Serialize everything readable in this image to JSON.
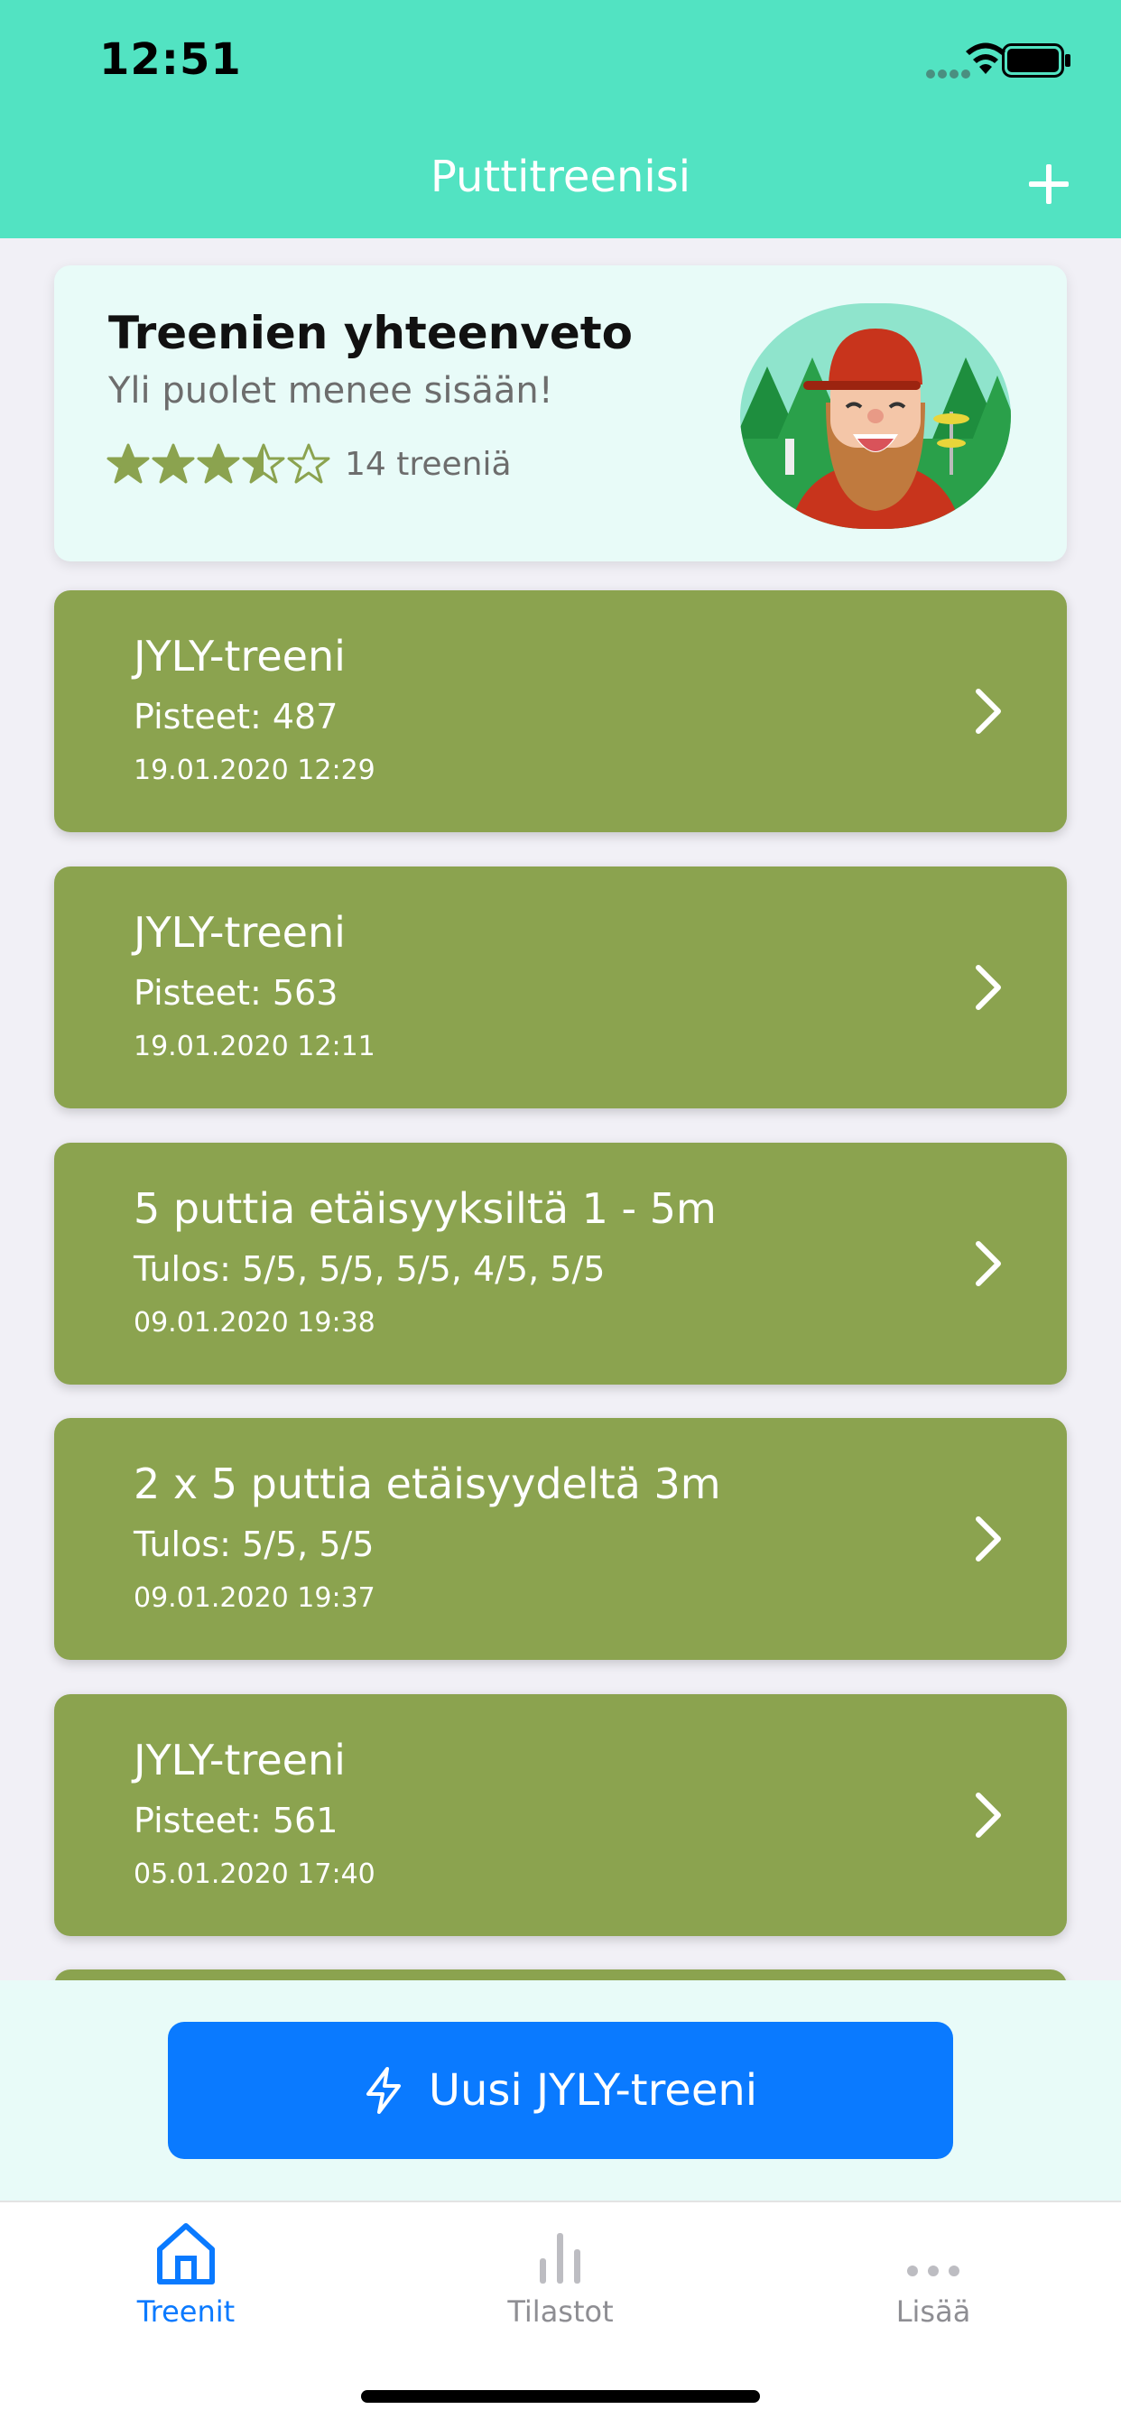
{
  "status_bar": {
    "time": "12:51"
  },
  "nav": {
    "title": "Puttitreenisi"
  },
  "summary": {
    "title": "Treenien yhteenveto",
    "subtitle": "Yli puolet menee sisään!",
    "rating": 3.5,
    "rating_max": 5,
    "count_text": "14 treeniä"
  },
  "workouts": [
    {
      "title": "JYLY-treeni",
      "detail": "Pisteet: 487",
      "date": "19.01.2020 12:29"
    },
    {
      "title": "JYLY-treeni",
      "detail": "Pisteet: 563",
      "date": "19.01.2020 12:11"
    },
    {
      "title": "5 puttia etäisyyksiltä 1 - 5m",
      "detail": "Tulos: 5/5, 5/5, 5/5, 4/5, 5/5",
      "date": "09.01.2020 19:38"
    },
    {
      "title": "2 x 5 puttia etäisyydeltä 3m",
      "detail": "Tulos: 5/5, 5/5",
      "date": "09.01.2020 19:37"
    },
    {
      "title": "JYLY-treeni",
      "detail": "Pisteet: 561",
      "date": "05.01.2020 17:40"
    }
  ],
  "action": {
    "new_button_label": "Uusi JYLY-treeni"
  },
  "tabs": [
    {
      "label": "Treenit",
      "icon": "home-icon",
      "active": true
    },
    {
      "label": "Tilastot",
      "icon": "bar-chart-icon",
      "active": false
    },
    {
      "label": "Lisää",
      "icon": "more-icon",
      "active": false
    }
  ],
  "colors": {
    "header": "#52E3C2",
    "card": "#8BA34F",
    "summary_bg": "#E8FBF8",
    "primary": "#0A7AFF",
    "star": "#8BA34F"
  }
}
